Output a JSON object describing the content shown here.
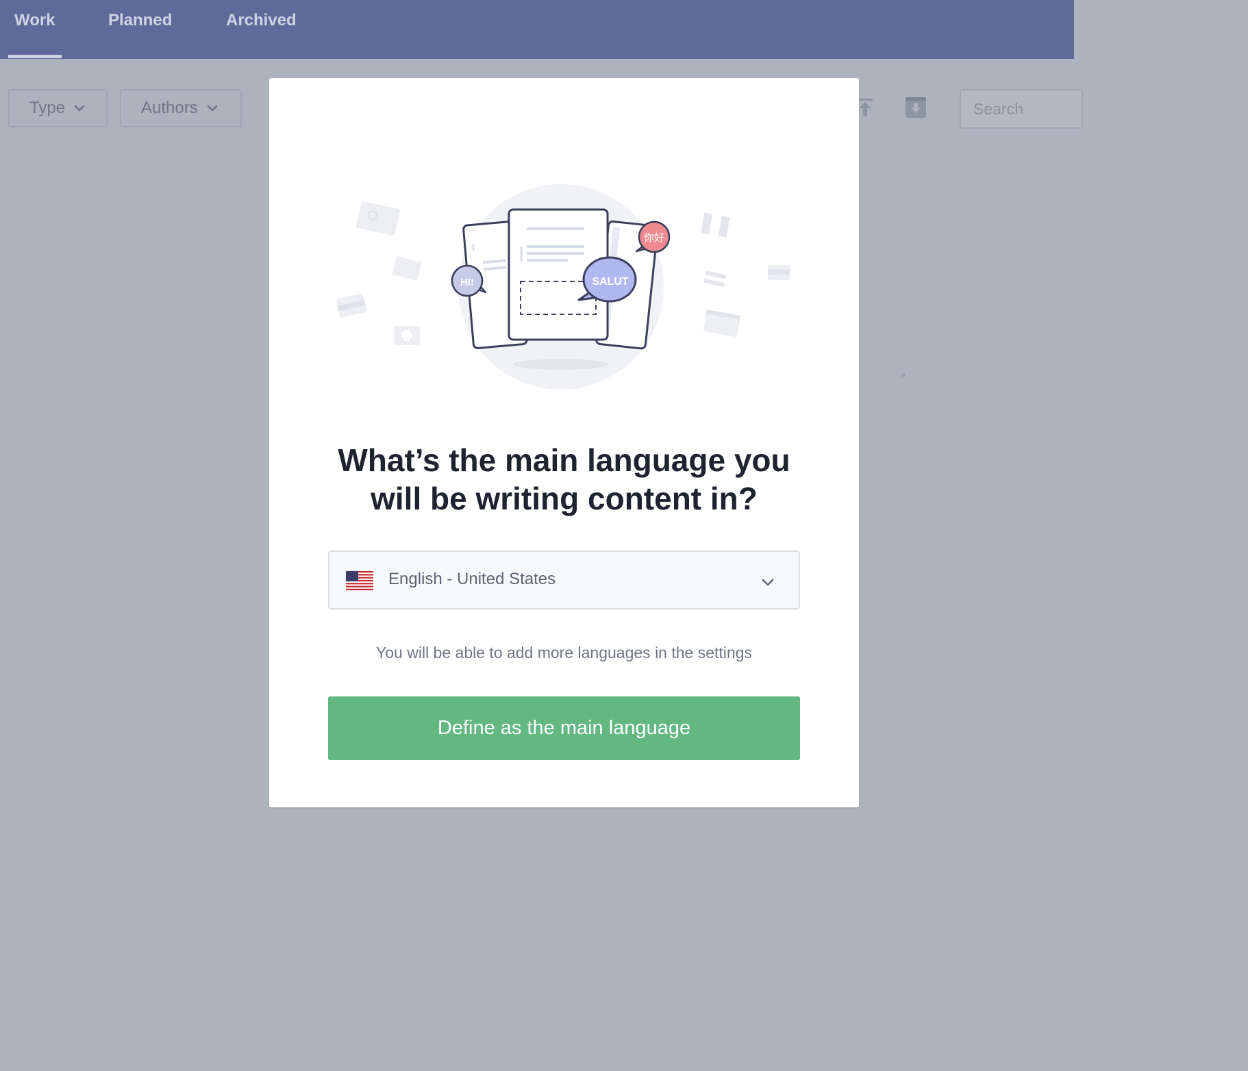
{
  "nav": {
    "tabs": [
      {
        "label": "Work"
      },
      {
        "label": "Planned"
      },
      {
        "label": "Archived"
      }
    ],
    "active_tab": "Work"
  },
  "toolbar": {
    "type_filter_label": "Type",
    "authors_filter_label": "Authors",
    "search_placeholder": "Search",
    "icons": [
      "upload-icon",
      "archive-download-icon"
    ]
  },
  "modal": {
    "illustration": {
      "bubbles": [
        "HI!",
        "SALUT",
        "你好"
      ]
    },
    "title_line1": "What’s the main language you",
    "title_line2": "will be writing content in?",
    "language_select": {
      "value": "English - United States",
      "flag": "us-flag-icon"
    },
    "hint": "You will be able to add more languages in the settings",
    "primary_button": "Define as the main language"
  },
  "colors": {
    "nav_bg": "#5f6a9b",
    "overlay_bg": "#adb3bd",
    "primary": "#63b882",
    "title": "#1f2230"
  }
}
